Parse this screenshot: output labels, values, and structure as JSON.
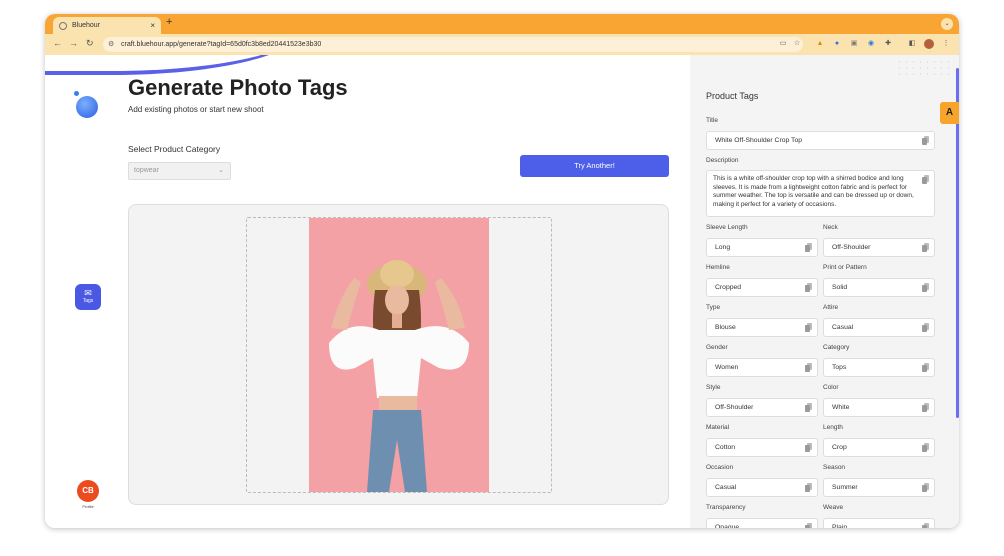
{
  "browser": {
    "tab_title": "Bluehour",
    "tab_close": "×",
    "new_tab": "+",
    "window_control": "⌄",
    "back": "←",
    "forward": "→",
    "reload": "↻",
    "url": "craft.bluehour.app/generate?tagId=65d0fc3b8ed20441523e3b30"
  },
  "page": {
    "title": "Generate Photo Tags",
    "subtitle": "Add existing photos or start new shoot",
    "category_label": "Select Product Category",
    "category_value": "topwear",
    "try_button": "Try Another!"
  },
  "sidebar": {
    "tags_label": "Tags",
    "avatar_initials": "CB",
    "profile_label": "Profile"
  },
  "panel": {
    "title": "Product Tags",
    "title_label": "Title",
    "title_value": "White Off-Shoulder Crop Top",
    "description_label": "Description",
    "description_value": "This is a white off-shoulder crop top with a shirred bodice and long sleeves. It is made from a lightweight cotton fabric and is perfect for summer weather. The top is versatile and can be dressed up or down, making it perfect for a variety of occasions.",
    "fields": [
      {
        "label": "Sleeve Length",
        "value": "Long"
      },
      {
        "label": "Neck",
        "value": "Off-Shoulder"
      },
      {
        "label": "Hemline",
        "value": "Cropped"
      },
      {
        "label": "Print or Pattern",
        "value": "Solid"
      },
      {
        "label": "Type",
        "value": "Blouse"
      },
      {
        "label": "Attire",
        "value": "Casual"
      },
      {
        "label": "Gender",
        "value": "Women"
      },
      {
        "label": "Category",
        "value": "Tops"
      },
      {
        "label": "Style",
        "value": "Off-Shoulder"
      },
      {
        "label": "Color",
        "value": "White"
      },
      {
        "label": "Material",
        "value": "Cotton"
      },
      {
        "label": "Length",
        "value": "Crop"
      },
      {
        "label": "Occasion",
        "value": "Casual"
      },
      {
        "label": "Season",
        "value": "Summer"
      },
      {
        "label": "Transparency",
        "value": "Opaque"
      },
      {
        "label": "Weave",
        "value": "Plain"
      }
    ]
  },
  "colors": {
    "browser_accent": "#f9a533",
    "primary": "#4d5ee8",
    "avatar": "#ec4b1f"
  }
}
